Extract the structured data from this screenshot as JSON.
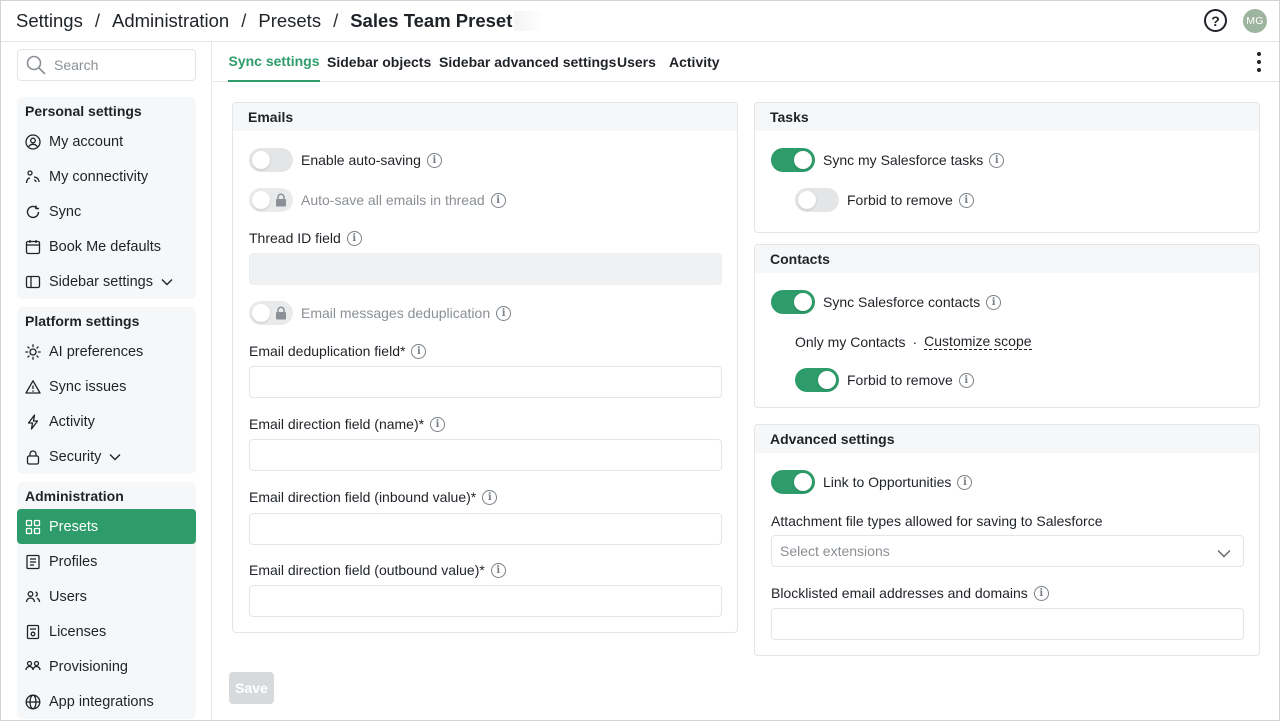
{
  "breadcrumb": {
    "items": [
      "Settings",
      "Administration",
      "Presets"
    ],
    "separator": "/",
    "current": "Sales Team Preset"
  },
  "header": {
    "help_label": "?",
    "avatar_initials": "MG"
  },
  "sidebar": {
    "search_placeholder": "Search",
    "groups": [
      {
        "title": "Personal settings",
        "items": [
          {
            "label": "My account",
            "icon": "user-circle-icon"
          },
          {
            "label": "My connectivity",
            "icon": "connectivity-icon"
          },
          {
            "label": "Sync",
            "icon": "sync-icon"
          },
          {
            "label": "Book Me defaults",
            "icon": "calendar-icon"
          },
          {
            "label": "Sidebar settings",
            "icon": "sidebar-icon",
            "expandable": true
          }
        ]
      },
      {
        "title": "Platform settings",
        "items": [
          {
            "label": "AI preferences",
            "icon": "sparkle-icon"
          },
          {
            "label": "Sync issues",
            "icon": "warning-icon"
          },
          {
            "label": "Activity",
            "icon": "lightning-icon"
          },
          {
            "label": "Security",
            "icon": "lock-icon",
            "expandable": true
          }
        ]
      },
      {
        "title": "Administration",
        "items": [
          {
            "label": "Presets",
            "icon": "grid-icon",
            "active": true
          },
          {
            "label": "Profiles",
            "icon": "profile-list-icon"
          },
          {
            "label": "Users",
            "icon": "users-icon"
          },
          {
            "label": "Licenses",
            "icon": "license-icon"
          },
          {
            "label": "Provisioning",
            "icon": "provisioning-icon"
          },
          {
            "label": "App integrations",
            "icon": "globe-icon"
          }
        ]
      }
    ]
  },
  "tabs": [
    {
      "label": "Sync settings",
      "active": true
    },
    {
      "label": "Sidebar objects"
    },
    {
      "label": "Sidebar advanced settings"
    },
    {
      "label": "Users"
    },
    {
      "label": "Activity"
    }
  ],
  "emails": {
    "title": "Emails",
    "auto_saving": {
      "label": "Enable auto-saving",
      "on": false
    },
    "auto_save_thread": {
      "label": "Auto-save all emails in thread",
      "locked": true
    },
    "thread_id": {
      "label": "Thread ID field",
      "value": ""
    },
    "dedup": {
      "label": "Email messages deduplication",
      "locked": true
    },
    "dedup_field": {
      "label": "Email deduplication field*",
      "value": ""
    },
    "direction_name": {
      "label": "Email direction field (name)*",
      "value": ""
    },
    "direction_inbound": {
      "label": "Email direction field (inbound value)*",
      "value": ""
    },
    "direction_outbound": {
      "label": "Email direction field (outbound value)*",
      "value": ""
    }
  },
  "tasks": {
    "title": "Tasks",
    "sync": {
      "label": "Sync my Salesforce tasks",
      "on": true
    },
    "forbid_remove": {
      "label": "Forbid to remove",
      "on": false
    }
  },
  "contacts": {
    "title": "Contacts",
    "sync": {
      "label": "Sync Salesforce contacts",
      "on": true
    },
    "scope_text": "Only my Contacts",
    "scope_separator": "·",
    "scope_link": "Customize scope",
    "forbid_remove": {
      "label": "Forbid to remove",
      "on": true
    }
  },
  "advanced": {
    "title": "Advanced settings",
    "link_opps": {
      "label": "Link to Opportunities",
      "on": true
    },
    "attachment_label": "Attachment file types allowed for saving to Salesforce",
    "attachment_placeholder": "Select extensions",
    "blocklist_label": "Blocklisted email addresses and domains",
    "blocklist_value": ""
  },
  "save_label": "Save",
  "colors": {
    "accent": "#2e9c6a",
    "toggle_off": "#e3e5e7",
    "panel_header": "#f6f7f8"
  }
}
